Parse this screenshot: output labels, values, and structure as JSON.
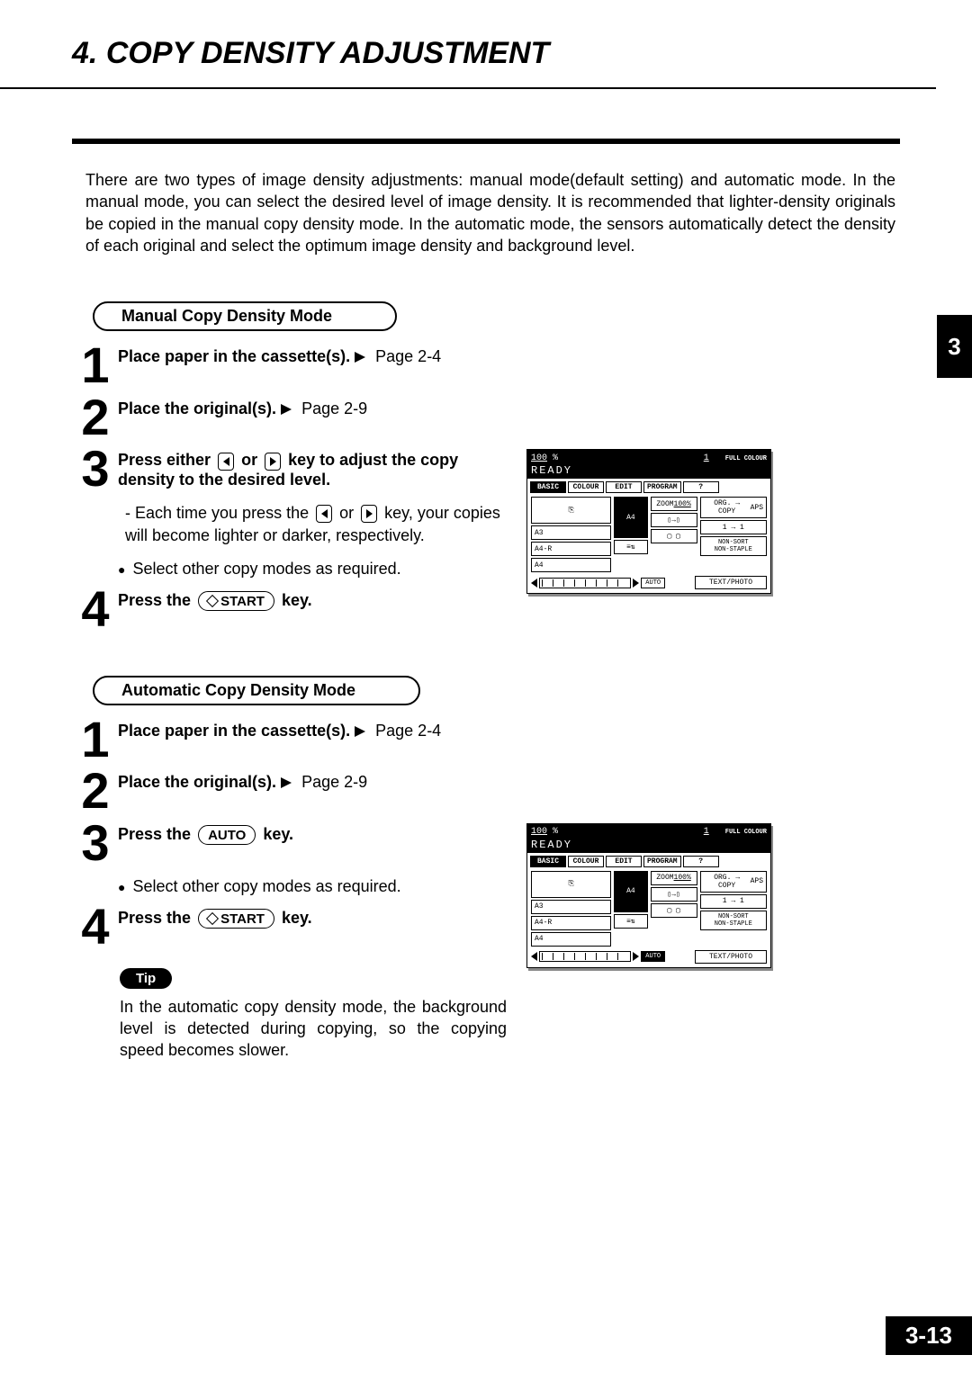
{
  "header": {
    "section_number": "4.",
    "title": "COPY DENSITY ADJUSTMENT"
  },
  "intro": "There are two types of image density adjustments: manual mode(default setting) and automatic mode. In the manual mode, you can select the desired level of image density. It is recommended that lighter-density originals be copied in the manual copy density mode.  In the automatic mode, the sensors automatically detect the density of each original and select the optimum image density and background level.",
  "chapter_tab": "3",
  "manual": {
    "heading": "Manual Copy Density Mode",
    "steps": {
      "s1": {
        "num": "1",
        "main": "Place paper in the cassette(s).",
        "ref": "Page 2-4"
      },
      "s2": {
        "num": "2",
        "main": "Place the original(s).",
        "ref": "Page 2-9"
      },
      "s3": {
        "num": "3",
        "main_a": "Press either",
        "main_b": "or",
        "main_c": "key to adjust the copy density to the desired level.",
        "sub": "-  Each time you press the     or     key, your copies will become lighter or darker, respectively.",
        "sub_prefix": "- Each time you press the",
        "sub_mid": "or",
        "sub_suffix": "key, your copies will become lighter or darker, respectively.",
        "bullet": "Select other copy modes as required."
      },
      "s4": {
        "num": "4",
        "main_a": "Press the",
        "key": "START",
        "main_b": "key."
      }
    }
  },
  "auto": {
    "heading": "Automatic Copy Density Mode",
    "steps": {
      "s1": {
        "num": "1",
        "main": "Place paper in the cassette(s).",
        "ref": "Page 2-4"
      },
      "s2": {
        "num": "2",
        "main": "Place the original(s).",
        "ref": "Page 2-9"
      },
      "s3": {
        "num": "3",
        "main_a": "Press the",
        "key": "AUTO",
        "main_b": "key.",
        "bullet": "Select other copy modes as required."
      },
      "s4": {
        "num": "4",
        "main_a": "Press the",
        "key": "START",
        "main_b": "key."
      }
    },
    "tip_label": "Tip",
    "tip_text": "In the automatic copy density mode, the background level is detected during copying, so the copying speed becomes slower."
  },
  "panel": {
    "zoom_pct": "100",
    "pct_sign": "%",
    "copies": "1",
    "mode": "FULL COLOUR",
    "status": "READY",
    "tabs": [
      "BASIC",
      "COLOUR",
      "EDIT",
      "PROGRAM"
    ],
    "zoom_label": "ZOOM",
    "zoom_val": "100%",
    "org_copy": "ORG. → COPY",
    "aps": "APS",
    "paper_a4": "A4",
    "paper_a3": "A3",
    "paper_a4r": "A4-R",
    "paper_a4_2": "A4",
    "one_to_one": "1 → 1",
    "sort": "NON-SORT\nNON-STAPLE",
    "auto_btn": "AUTO",
    "text_photo": "TEXT/PHOTO"
  },
  "page_number": "3-13"
}
